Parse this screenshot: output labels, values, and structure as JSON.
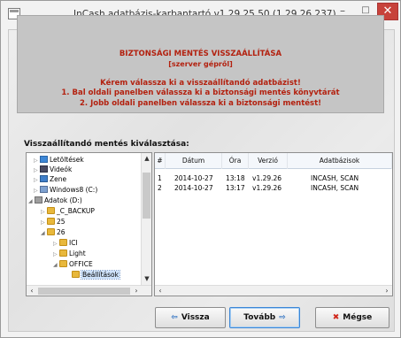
{
  "window": {
    "title": "InCash adatbázis-karbantartó v1.29.25.50 (1.29.26.237)",
    "minimize_glyph": "–",
    "maximize_glyph": "□",
    "close_glyph": "✕"
  },
  "banner": {
    "heading": "BIZTONSÁGI MENTÉS VISSZAÁLLÍTÁSA",
    "subheading": "[szerver gépről]",
    "line1": "Kérem válassza ki a visszaállítandó adatbázist!",
    "line2": "1. Bal oldali panelben válassza ki a biztonsági mentés könyvtárát",
    "line3": "2. Jobb oldali panelben válassza ki a biztonsági mentést!",
    "color": "#b3210f",
    "background": "#c5c5c5"
  },
  "selection_label": "Visszaállítandó mentés kiválasztása:",
  "tree": {
    "items": [
      {
        "label": "Letöltések",
        "icon": "download-folder-icon",
        "expander": "▷"
      },
      {
        "label": "Videók",
        "icon": "videos-folder-icon",
        "expander": "▷"
      },
      {
        "label": "Zene",
        "icon": "music-folder-icon",
        "expander": "▷"
      },
      {
        "label": "Windows8 (C:)",
        "icon": "drive-icon",
        "expander": "▷"
      },
      {
        "label": "Adatok (D:)",
        "icon": "drive-icon",
        "expander": "◢"
      },
      {
        "label": "_C_BACKUP",
        "icon": "folder-icon",
        "expander": "▷"
      },
      {
        "label": "25",
        "icon": "folder-icon",
        "expander": "▷"
      },
      {
        "label": "26",
        "icon": "folder-icon",
        "expander": "◢"
      },
      {
        "label": "ICI",
        "icon": "folder-icon",
        "expander": "▷"
      },
      {
        "label": "Light",
        "icon": "folder-icon",
        "expander": "▷"
      },
      {
        "label": "OFFICE",
        "icon": "folder-icon",
        "expander": "◢"
      },
      {
        "label": "Beállítások",
        "icon": "folder-icon",
        "expander": ""
      }
    ],
    "selected": "Beállítások"
  },
  "list": {
    "columns": [
      "#",
      "Dátum",
      "Óra",
      "Verzió",
      "Adatbázisok"
    ],
    "rows": [
      [
        "1",
        "2014-10-27",
        "13:18",
        "v1.29.26",
        "INCASH, SCAN"
      ],
      [
        "2",
        "2014-10-27",
        "13:17",
        "v1.29.26",
        "INCASH, SCAN"
      ]
    ]
  },
  "buttons": {
    "back_label": "Vissza",
    "back_icon": "⇦",
    "next_label": "Tovább",
    "next_icon": "⇨",
    "cancel_label": "Mégse",
    "cancel_icon": "✖"
  },
  "colors": {
    "back_icon": "#2b6fc2",
    "next_icon": "#2b6fc2",
    "cancel_icon": "#d0281c",
    "close_button": "#c7423b"
  }
}
